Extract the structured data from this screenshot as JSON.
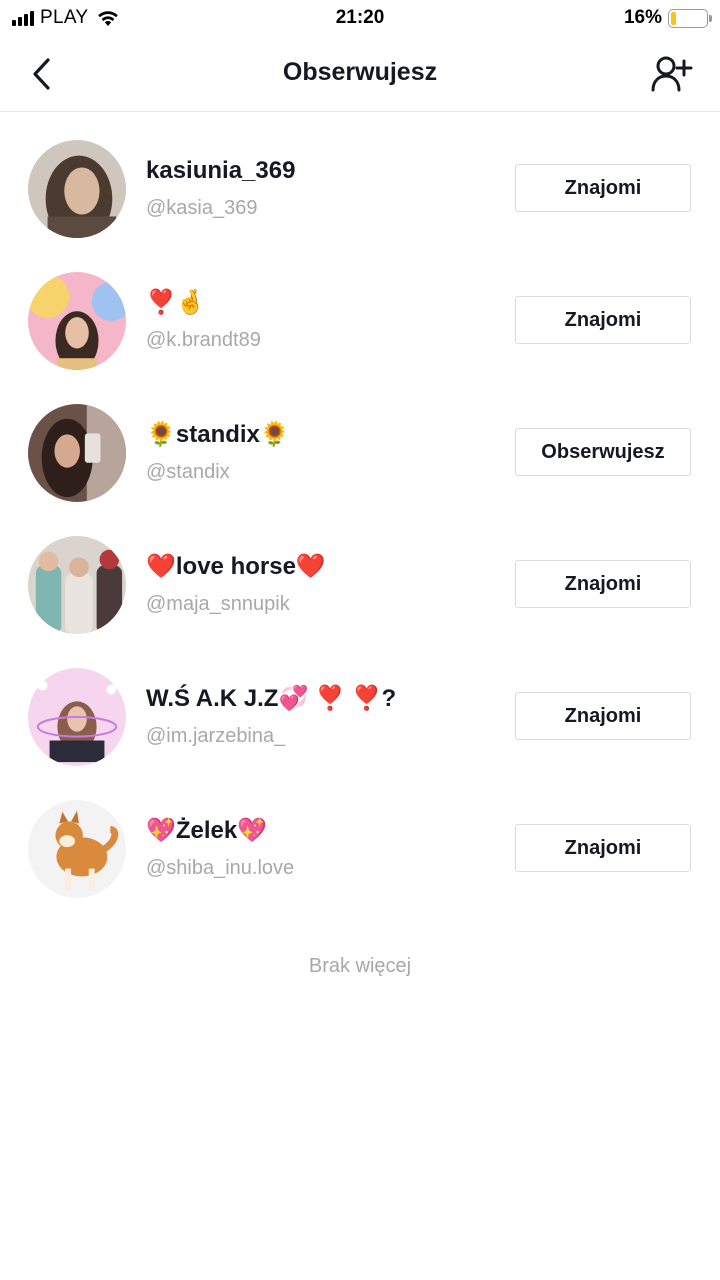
{
  "status_bar": {
    "carrier": "PLAY",
    "time": "21:20",
    "battery_percent": "16%",
    "battery_level": 0.16,
    "battery_color": "#f5c518"
  },
  "header": {
    "title": "Obserwujesz",
    "back_icon": "chevron-left-icon",
    "add_user_icon": "add-user-icon"
  },
  "following": [
    {
      "display_name": "kasiunia_369",
      "username": "@kasia_369",
      "button": "Znajomi"
    },
    {
      "display_name": "❣️🤞",
      "username": "@k.brandt89",
      "button": "Znajomi"
    },
    {
      "display_name": "🌻standix🌻",
      "username": "@standix",
      "button": "Obserwujesz"
    },
    {
      "display_name": "❤️love horse❤️",
      "username": "@maja_snnupik",
      "button": "Znajomi"
    },
    {
      "display_name": "W.Ś  A.K J.Z💞 ❣️ ❣️?",
      "username": "@im.jarzebina_",
      "button": "Znajomi"
    },
    {
      "display_name": "💖Żelek💖",
      "username": "@shiba_inu.love",
      "button": "Znajomi"
    }
  ],
  "footer": {
    "no_more": "Brak więcej"
  },
  "colors": {
    "text": "#161823",
    "secondary": "#a7a8ad",
    "border": "#dcdce0"
  }
}
